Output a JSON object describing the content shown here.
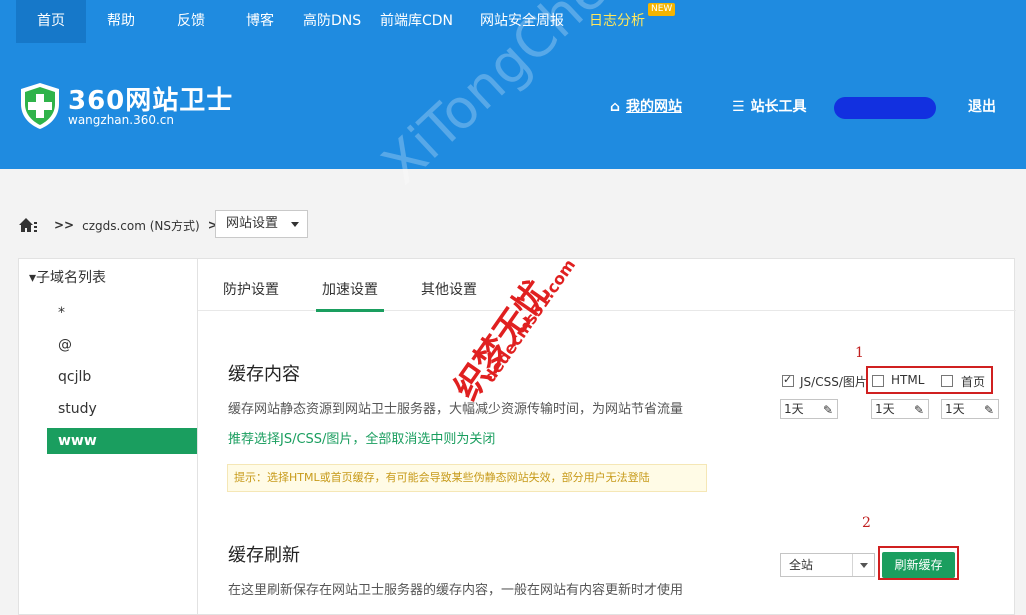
{
  "topnav": {
    "items": [
      "首页",
      "帮助",
      "反馈",
      "博客",
      "高防DNS",
      "前端库CDN",
      "网站安全周报",
      "日志分析"
    ],
    "new_badge": "NEW"
  },
  "header": {
    "logo_title": "360网站卫士",
    "logo_sub": "wangzhan.360.cn",
    "my_site": "我的网站",
    "tools": "站长工具",
    "logout": "退出"
  },
  "breadcrumb": {
    "domain": "czgds.com (NS方式)",
    "sep": ">>",
    "select_value": "网站设置"
  },
  "sidebar": {
    "title": "子域名列表",
    "items": [
      "*",
      "@",
      "qcjlb",
      "study",
      "www"
    ]
  },
  "tabs": [
    "防护设置",
    "加速设置",
    "其他设置"
  ],
  "cache": {
    "title": "缓存内容",
    "desc": "缓存网站静态资源到网站卫士服务器，大幅减少资源传输时间，为网站节省流量",
    "recommend": "推荐选择JS/CSS/图片，全部取消选中则为关闭",
    "tip": "提示：选择HTML或首页缓存，有可能会导致某些伪静态网站失效，部分用户无法登陆",
    "opt_js": "JS/CSS/图片",
    "opt_html": "HTML",
    "opt_home": "首页",
    "day": "1天"
  },
  "refresh": {
    "title": "缓存刷新",
    "desc": "在这里刷新保存在网站卫士服务器的缓存内容，一般在网站有内容更新时才使用",
    "select_value": "全站",
    "button": "刷新缓存"
  },
  "annotations": {
    "mark1": "1",
    "mark2": "2",
    "stamp": "织梦无忧",
    "stamp_url": "dedecms51.com",
    "stamp_url2": ".com",
    "watermark": "XiTongCheng.Com"
  },
  "colors": {
    "header_blue": "#1f8be0",
    "accent_green": "#1a9e5f",
    "annotation_red": "#d02020"
  }
}
